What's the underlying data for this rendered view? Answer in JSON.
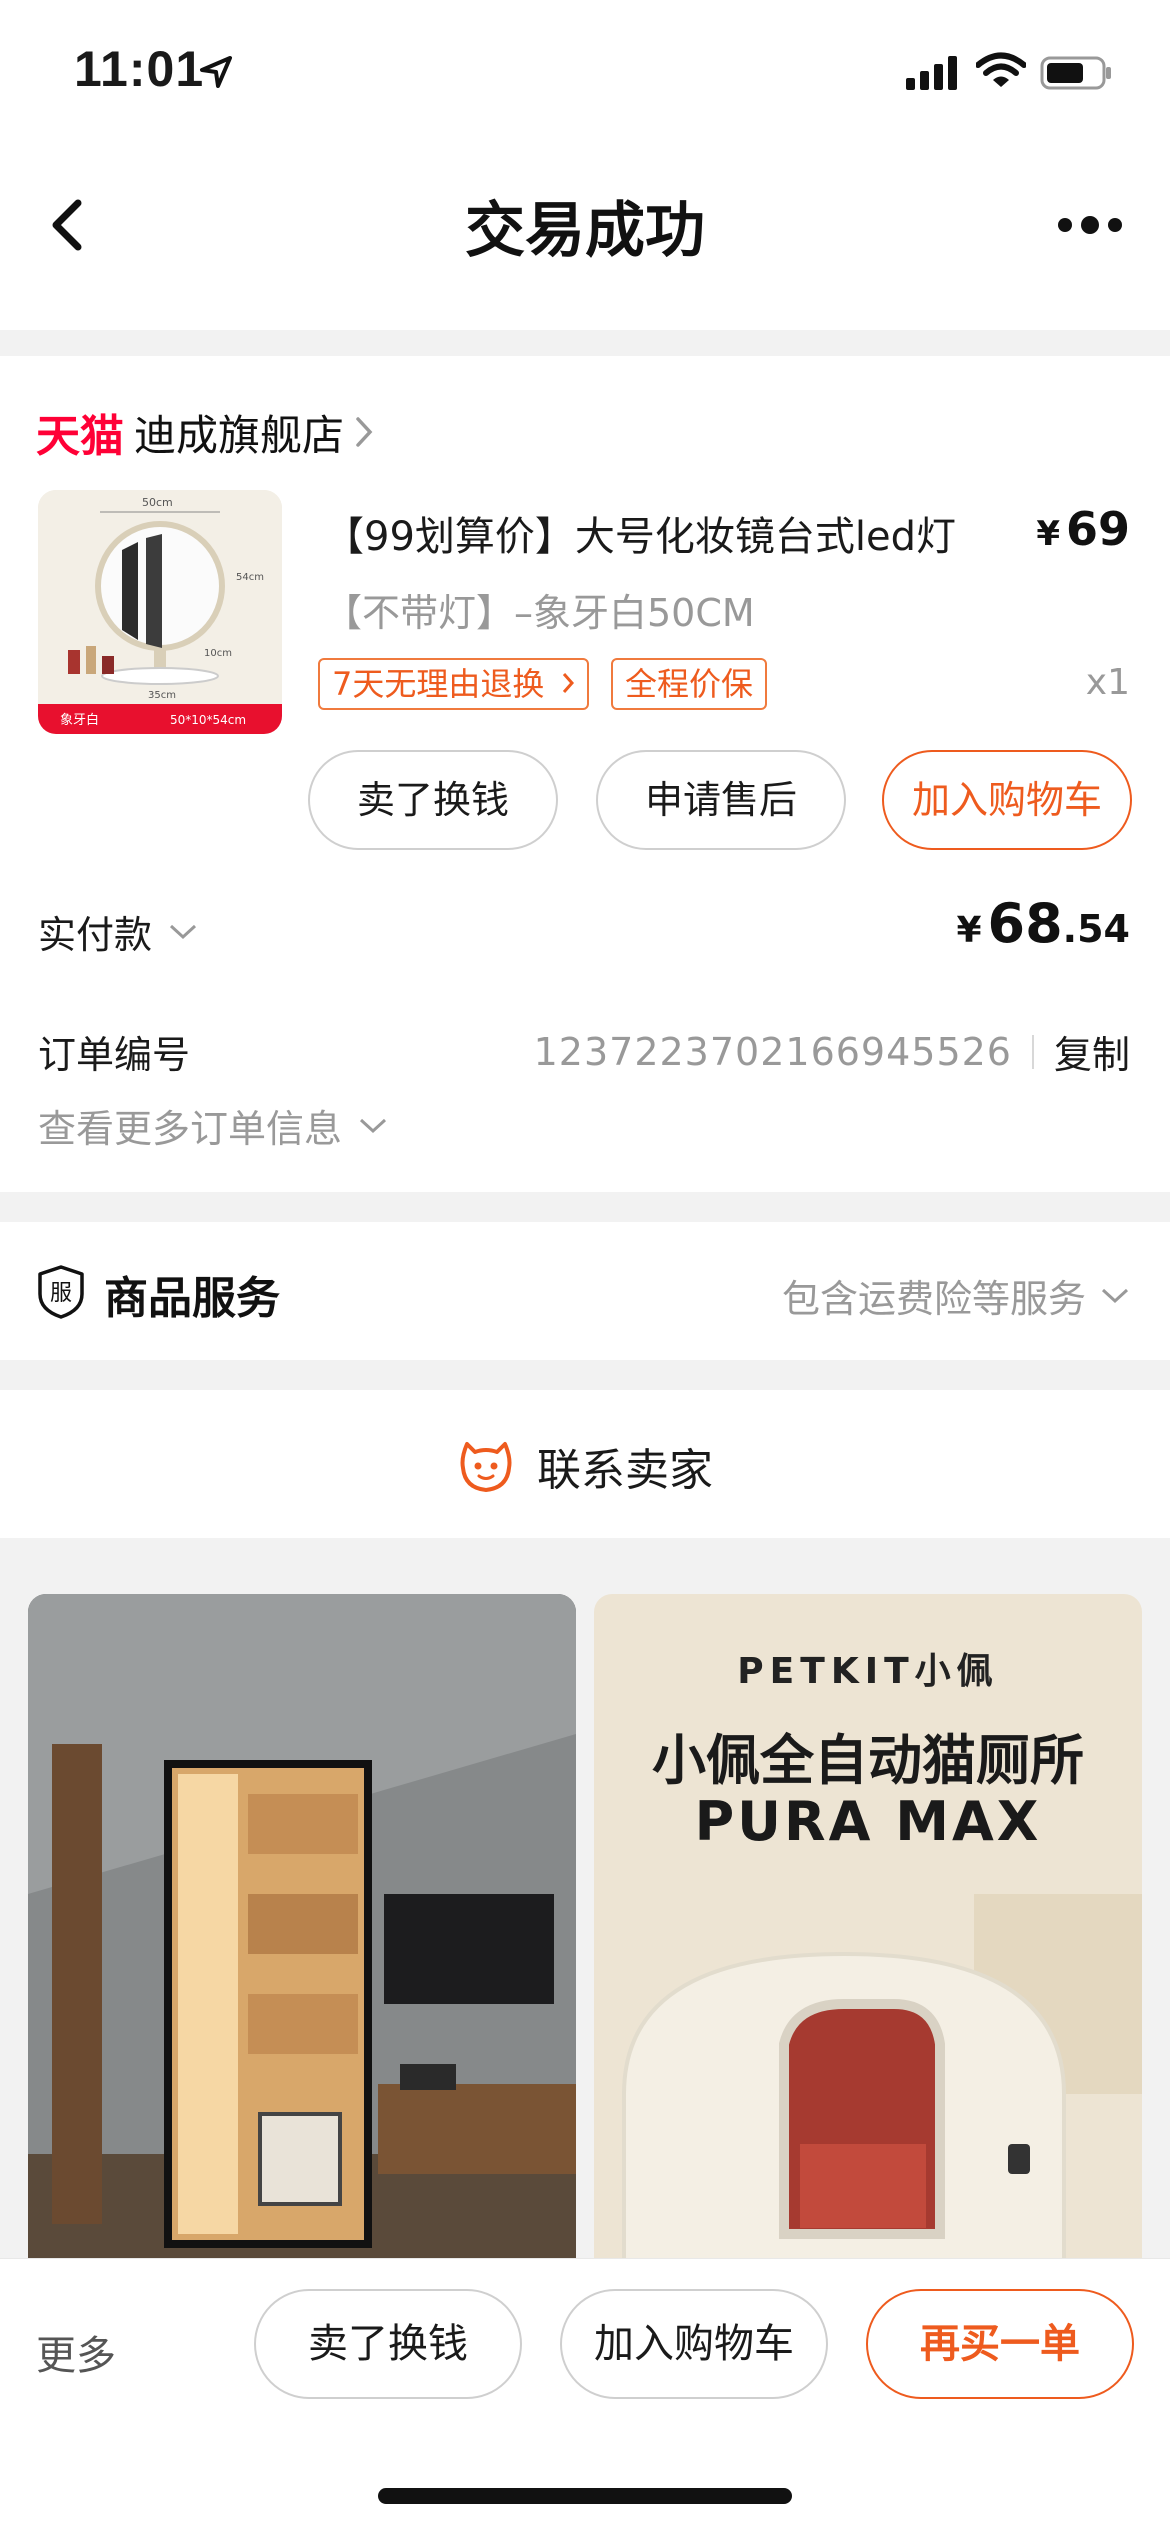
{
  "status_bar": {
    "time": "11:01"
  },
  "nav": {
    "title": "交易成功"
  },
  "order": {
    "platform_logo": "天猫",
    "shop_name": "迪成旗舰店",
    "product": {
      "title": "【99划算价】大号化妆镜台式led灯",
      "price_symbol": "¥",
      "price": "69",
      "sku": "【不带灯】–象牙白50CM",
      "tags": [
        "7天无理由退换",
        "全程价保"
      ],
      "quantity": "x1",
      "image_labels": {
        "width": "50cm",
        "height": "54cm",
        "depth": "10cm",
        "base": "35cm",
        "color": "象牙白",
        "size": "50*10*54cm"
      }
    },
    "actions": {
      "sell": "卖了换钱",
      "after_sale": "申请售后",
      "add_cart": "加入购物车"
    },
    "paid": {
      "label": "实付款",
      "symbol": "¥",
      "integer": "68",
      "decimal": ".54"
    },
    "order_number": {
      "label": "订单编号",
      "value": "1237223702166945526",
      "copy": "复制"
    },
    "more_info": "查看更多订单信息"
  },
  "service": {
    "icon_text": "服",
    "title": "商品服务",
    "description": "包含运费险等服务"
  },
  "contact": {
    "label": "联系卖家"
  },
  "recommendations": [
    {
      "kind": "photo"
    },
    {
      "brand": "PETKIT小佩",
      "headline": "小佩全自动猫厕所",
      "model": "PURA MAX"
    }
  ],
  "bottom_bar": {
    "more": "更多",
    "sell": "卖了换钱",
    "add_cart": "加入购物车",
    "rebuy": "再买一单"
  },
  "colors": {
    "accent": "#ee5b1e",
    "tmall_red": "#ff0036",
    "muted_text": "#999999"
  }
}
